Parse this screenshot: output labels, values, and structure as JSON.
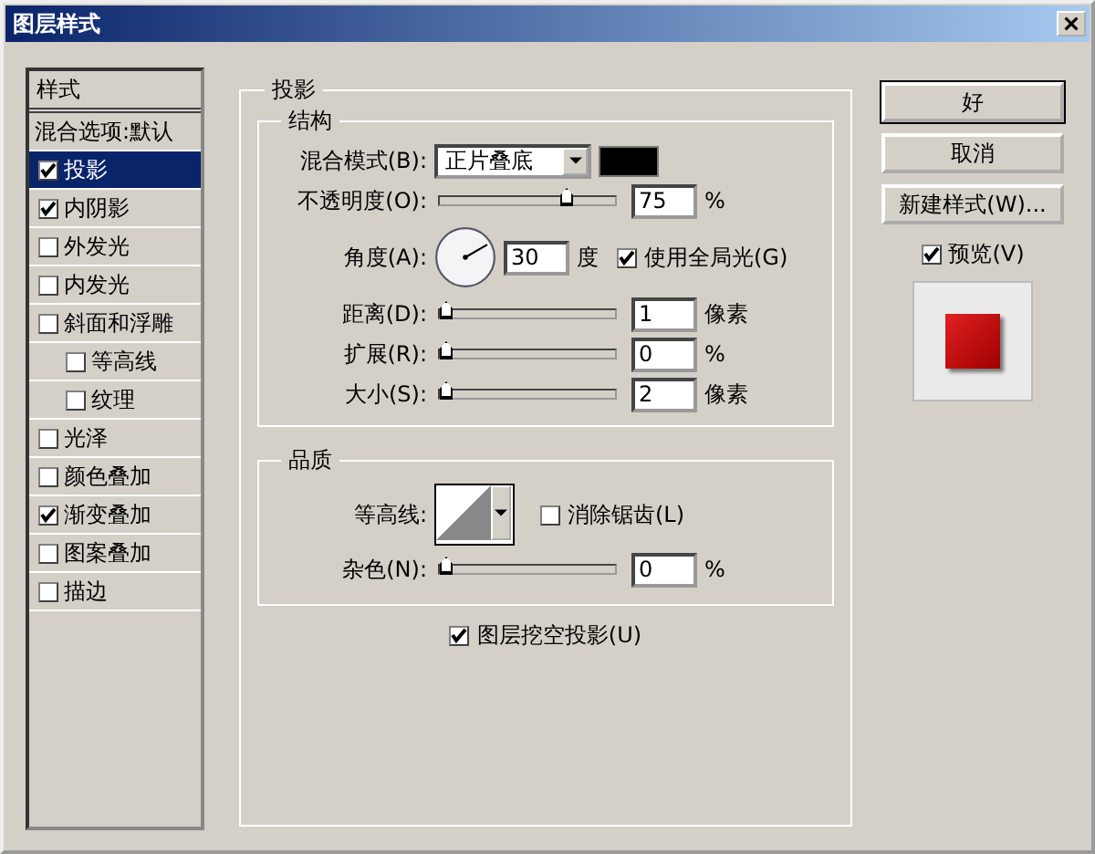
{
  "window": {
    "title": "图层样式"
  },
  "styles_panel": {
    "header": "样式",
    "blend_options": "混合选项:默认",
    "items": [
      {
        "label": "投影",
        "checked": true,
        "selected": true
      },
      {
        "label": "内阴影",
        "checked": true,
        "selected": false
      },
      {
        "label": "外发光",
        "checked": false,
        "selected": false
      },
      {
        "label": "内发光",
        "checked": false,
        "selected": false
      },
      {
        "label": "斜面和浮雕",
        "checked": false,
        "selected": false,
        "children": [
          {
            "label": "等高线",
            "checked": false,
            "selected": false
          },
          {
            "label": "纹理",
            "checked": false,
            "selected": false
          }
        ]
      },
      {
        "label": "光泽",
        "checked": false,
        "selected": false
      },
      {
        "label": "颜色叠加",
        "checked": false,
        "selected": false
      },
      {
        "label": "渐变叠加",
        "checked": true,
        "selected": false
      },
      {
        "label": "图案叠加",
        "checked": false,
        "selected": false
      },
      {
        "label": "描边",
        "checked": false,
        "selected": false
      }
    ]
  },
  "drop_shadow": {
    "title": "投影",
    "structure": {
      "title": "结构",
      "blend_mode": {
        "label": "混合模式(B):",
        "value": "正片叠底",
        "color": "#000000"
      },
      "rows": [
        {
          "kind": "slider",
          "label": "不透明度(O):",
          "level": 0.75,
          "value": "75",
          "unit": "%"
        },
        {
          "kind": "angle",
          "label": "角度(A):",
          "value": "30",
          "unit": "度",
          "global_light": {
            "label": "使用全局光(G)",
            "checked": true
          }
        },
        {
          "kind": "slider",
          "label": "距离(D):",
          "level": 0,
          "value": "1",
          "unit": "像素"
        },
        {
          "kind": "slider",
          "label": "扩展(R):",
          "level": 0,
          "value": "0",
          "unit": "%"
        },
        {
          "kind": "slider",
          "label": "大小(S):",
          "level": 0,
          "value": "2",
          "unit": "像素"
        }
      ]
    },
    "quality": {
      "title": "品质",
      "contour": {
        "label": "等高线:"
      },
      "anti_alias": {
        "label": "消除锯齿(L)",
        "checked": false
      },
      "noise": {
        "label": "杂色(N):",
        "level": 0,
        "value": "0",
        "unit": "%"
      }
    },
    "knockout": {
      "label": "图层挖空投影(U)",
      "checked": true
    }
  },
  "buttons": [
    "好",
    "取消",
    "新建样式(W)..."
  ],
  "preview": {
    "label": "预览(V)",
    "checked": true
  }
}
